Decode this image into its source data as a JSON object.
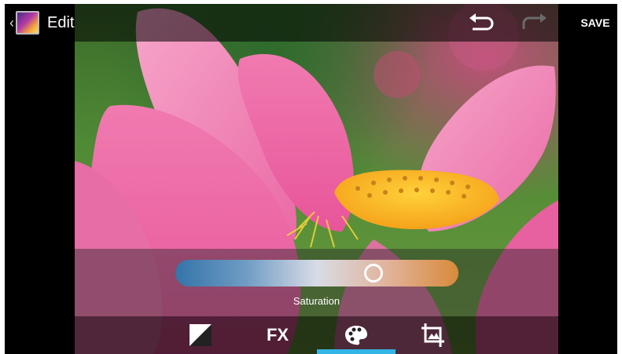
{
  "actionbar": {
    "title": "Edit",
    "save_label": "SAVE",
    "icons": [
      "up-caret-icon",
      "app-icon",
      "undo-icon",
      "redo-icon"
    ]
  },
  "slider": {
    "label": "Saturation",
    "value_fraction": 0.72,
    "gradient_colors": [
      "#3474a8",
      "#d8dce6",
      "#d88a3a"
    ]
  },
  "toolbar": {
    "tools": [
      {
        "name": "exposure",
        "icon": "exposure-icon"
      },
      {
        "name": "fx",
        "label": "FX"
      },
      {
        "name": "color",
        "icon": "palette-icon",
        "selected": true
      },
      {
        "name": "crop",
        "icon": "crop-icon"
      }
    ],
    "accent": "#33b5e5"
  }
}
